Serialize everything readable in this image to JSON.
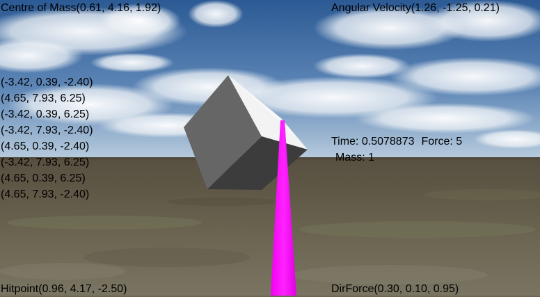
{
  "hud": {
    "centre_of_mass": "Centre of Mass(0.61, 4.16, 1.92)",
    "angular_velocity": "Angular Velocity(1.26, -1.25, 0.21)",
    "vertices": [
      "(-3.42, 0.39, -2.40)",
      "(4.65, 7.93, 6.25)",
      "(-3.42, 0.39, 6.25)",
      "(-3.42, 7.93, -2.40)",
      "(4.65, 0.39, -2.40)",
      "(-3.42, 7.93, 6.25)",
      "(4.65, 0.39, 6.25)",
      "(4.65, 7.93, -2.40)"
    ],
    "time": "Time: 0.5078873",
    "force": "Force: 5",
    "mass": "Mass: 1",
    "hitpoint": "Hitpoint(0.96, 4.17, -2.50)",
    "dir_force": "DirForce(0.30, 0.10, 0.95)"
  },
  "colors": {
    "sky_top": "#2f5d96",
    "sky_horizon": "#b9cde0",
    "ground_far": "#5e5646",
    "ground_near": "#6d6a55",
    "cube_left": "#666666",
    "cube_top": "#f2f2f2",
    "cube_right": "#3d3d3d",
    "force_ray": "#ff00ff"
  }
}
